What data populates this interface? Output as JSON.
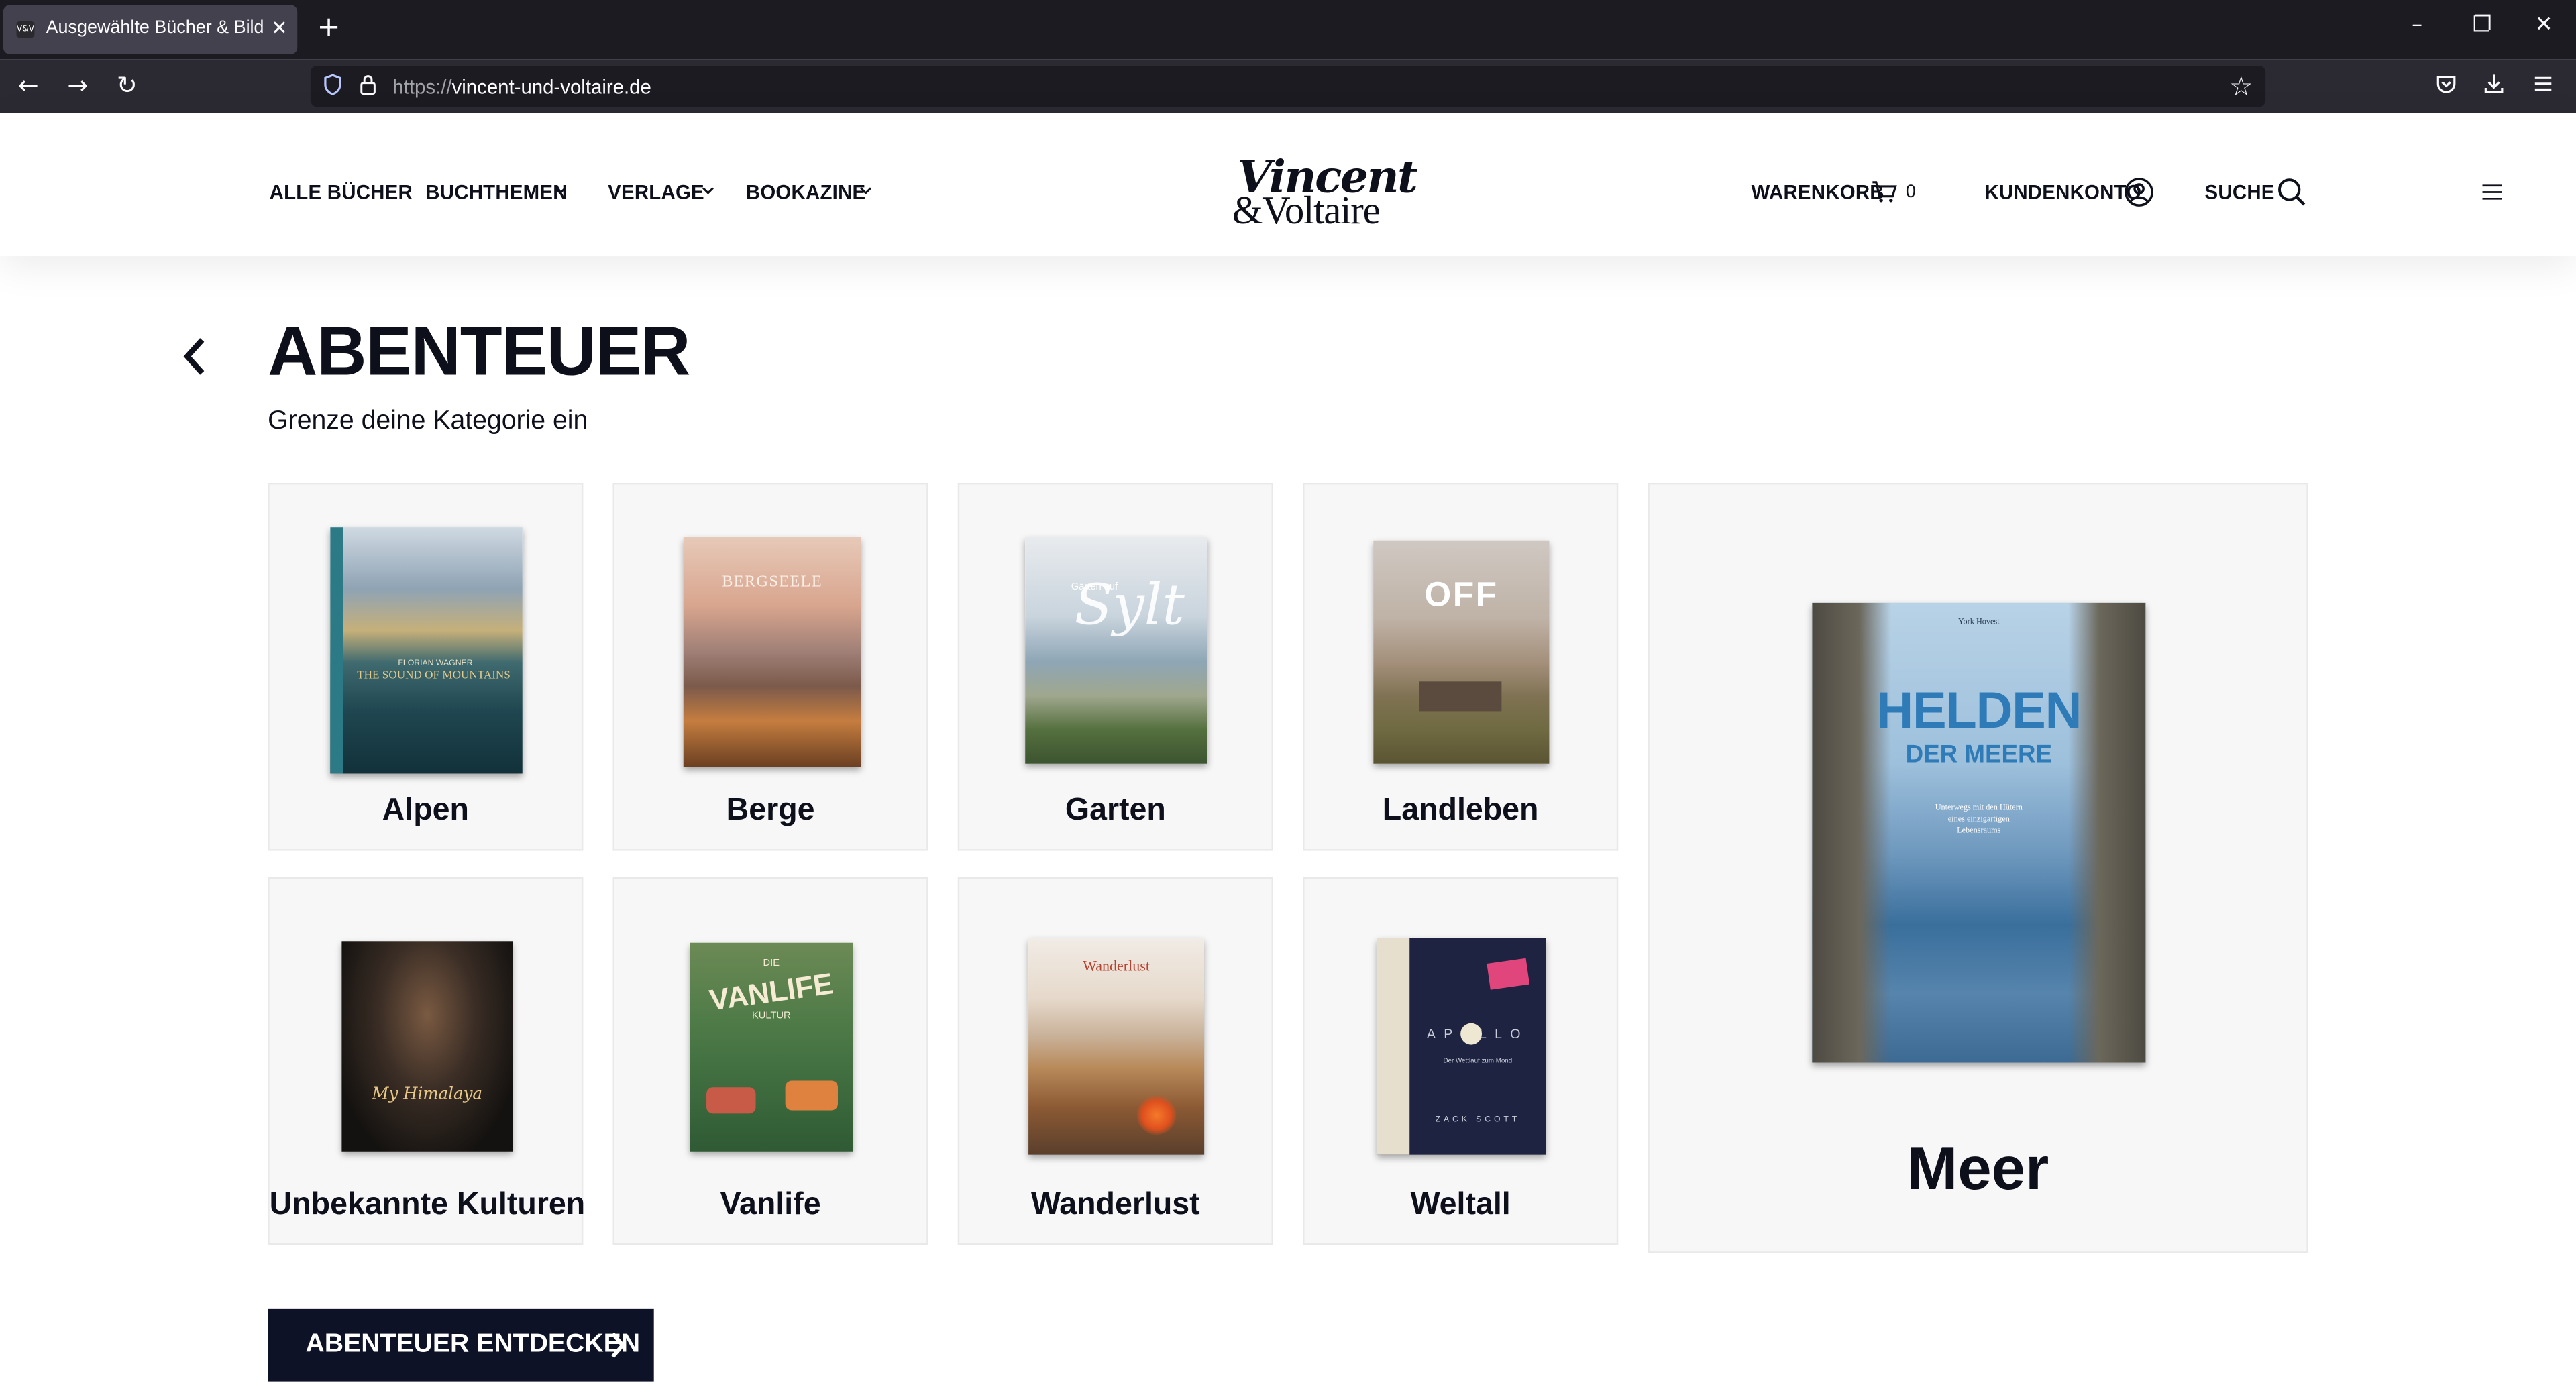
{
  "browser": {
    "tab_title": "Ausgewählte Bücher & Bildbände",
    "favicon_text": "V&V",
    "url_scheme": "https://",
    "url_host": "vincent-und-voltaire.de"
  },
  "site": {
    "logo_line1": "Vincent",
    "logo_line2": "&Voltaire",
    "nav": {
      "all_books": "ALLE BÜCHER",
      "topics": "BUCHTHEMEN",
      "publishers": "VERLAGE",
      "bookazine": "BOOKAZINE"
    },
    "actions": {
      "cart_label": "WARENKORB",
      "cart_count": "0",
      "account_label": "KUNDENKONTO",
      "search_label": "SUCHE"
    }
  },
  "page": {
    "title": "ABENTEUER",
    "subtitle": "Grenze deine Kategorie ein",
    "categories": [
      {
        "label": "Alpen",
        "cover_text": "THE SOUND OF MOUNTAINS",
        "cover_author": "FLORIAN WAGNER"
      },
      {
        "label": "Berge",
        "cover_text": "BERGSEELE"
      },
      {
        "label": "Garten",
        "cover_text": "Sylt",
        "cover_small": "Gärten auf"
      },
      {
        "label": "Landleben",
        "cover_text": "OFF"
      },
      {
        "label": "Unbekannte Kulturen",
        "cover_text": "My Himalaya"
      },
      {
        "label": "Vanlife",
        "cover_text": "VANLIFE",
        "cover_small": "DIE",
        "cover_sub": "KULTUR"
      },
      {
        "label": "Wanderlust",
        "cover_text": "Wanderlust"
      },
      {
        "label": "Weltall",
        "cover_text": "APOLLO",
        "cover_sub": "Der Wettlauf zum Mond",
        "cover_author": "ZACK SCOTT"
      }
    ],
    "featured": {
      "label": "Meer",
      "cover_author": "York Hovest",
      "cover_title1": "HELDEN",
      "cover_title2": "DER MEERE",
      "cover_sub": "Unterwegs mit den Hütern eines einzigartigen Lebensraums"
    },
    "cta_label": "ABENTEUER ENTDECKEN"
  }
}
